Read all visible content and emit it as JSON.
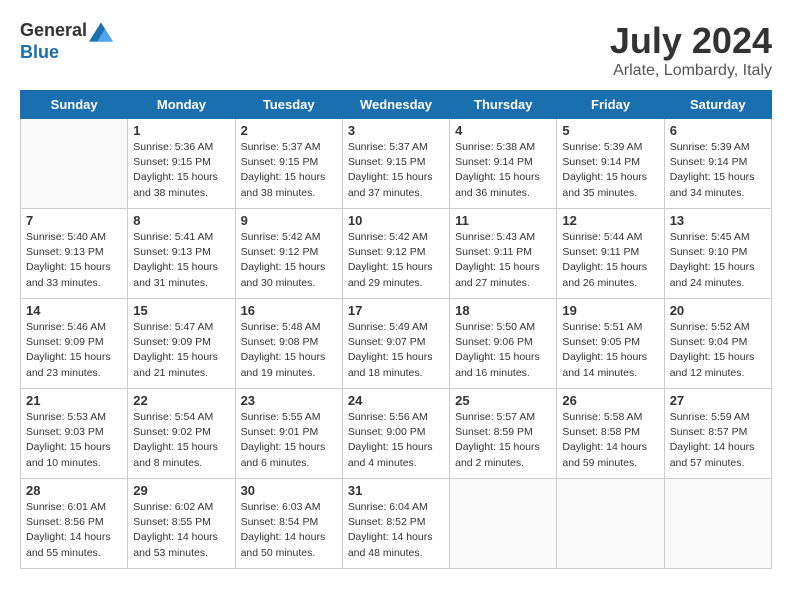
{
  "header": {
    "logo": {
      "general": "General",
      "blue": "Blue"
    },
    "title": "July 2024",
    "location": "Arlate, Lombardy, Italy"
  },
  "days_of_week": [
    "Sunday",
    "Monday",
    "Tuesday",
    "Wednesday",
    "Thursday",
    "Friday",
    "Saturday"
  ],
  "weeks": [
    [
      {
        "day": "",
        "info": ""
      },
      {
        "day": "1",
        "info": "Sunrise: 5:36 AM\nSunset: 9:15 PM\nDaylight: 15 hours\nand 38 minutes."
      },
      {
        "day": "2",
        "info": "Sunrise: 5:37 AM\nSunset: 9:15 PM\nDaylight: 15 hours\nand 38 minutes."
      },
      {
        "day": "3",
        "info": "Sunrise: 5:37 AM\nSunset: 9:15 PM\nDaylight: 15 hours\nand 37 minutes."
      },
      {
        "day": "4",
        "info": "Sunrise: 5:38 AM\nSunset: 9:14 PM\nDaylight: 15 hours\nand 36 minutes."
      },
      {
        "day": "5",
        "info": "Sunrise: 5:39 AM\nSunset: 9:14 PM\nDaylight: 15 hours\nand 35 minutes."
      },
      {
        "day": "6",
        "info": "Sunrise: 5:39 AM\nSunset: 9:14 PM\nDaylight: 15 hours\nand 34 minutes."
      }
    ],
    [
      {
        "day": "7",
        "info": "Sunrise: 5:40 AM\nSunset: 9:13 PM\nDaylight: 15 hours\nand 33 minutes."
      },
      {
        "day": "8",
        "info": "Sunrise: 5:41 AM\nSunset: 9:13 PM\nDaylight: 15 hours\nand 31 minutes."
      },
      {
        "day": "9",
        "info": "Sunrise: 5:42 AM\nSunset: 9:12 PM\nDaylight: 15 hours\nand 30 minutes."
      },
      {
        "day": "10",
        "info": "Sunrise: 5:42 AM\nSunset: 9:12 PM\nDaylight: 15 hours\nand 29 minutes."
      },
      {
        "day": "11",
        "info": "Sunrise: 5:43 AM\nSunset: 9:11 PM\nDaylight: 15 hours\nand 27 minutes."
      },
      {
        "day": "12",
        "info": "Sunrise: 5:44 AM\nSunset: 9:11 PM\nDaylight: 15 hours\nand 26 minutes."
      },
      {
        "day": "13",
        "info": "Sunrise: 5:45 AM\nSunset: 9:10 PM\nDaylight: 15 hours\nand 24 minutes."
      }
    ],
    [
      {
        "day": "14",
        "info": "Sunrise: 5:46 AM\nSunset: 9:09 PM\nDaylight: 15 hours\nand 23 minutes."
      },
      {
        "day": "15",
        "info": "Sunrise: 5:47 AM\nSunset: 9:09 PM\nDaylight: 15 hours\nand 21 minutes."
      },
      {
        "day": "16",
        "info": "Sunrise: 5:48 AM\nSunset: 9:08 PM\nDaylight: 15 hours\nand 19 minutes."
      },
      {
        "day": "17",
        "info": "Sunrise: 5:49 AM\nSunset: 9:07 PM\nDaylight: 15 hours\nand 18 minutes."
      },
      {
        "day": "18",
        "info": "Sunrise: 5:50 AM\nSunset: 9:06 PM\nDaylight: 15 hours\nand 16 minutes."
      },
      {
        "day": "19",
        "info": "Sunrise: 5:51 AM\nSunset: 9:05 PM\nDaylight: 15 hours\nand 14 minutes."
      },
      {
        "day": "20",
        "info": "Sunrise: 5:52 AM\nSunset: 9:04 PM\nDaylight: 15 hours\nand 12 minutes."
      }
    ],
    [
      {
        "day": "21",
        "info": "Sunrise: 5:53 AM\nSunset: 9:03 PM\nDaylight: 15 hours\nand 10 minutes."
      },
      {
        "day": "22",
        "info": "Sunrise: 5:54 AM\nSunset: 9:02 PM\nDaylight: 15 hours\nand 8 minutes."
      },
      {
        "day": "23",
        "info": "Sunrise: 5:55 AM\nSunset: 9:01 PM\nDaylight: 15 hours\nand 6 minutes."
      },
      {
        "day": "24",
        "info": "Sunrise: 5:56 AM\nSunset: 9:00 PM\nDaylight: 15 hours\nand 4 minutes."
      },
      {
        "day": "25",
        "info": "Sunrise: 5:57 AM\nSunset: 8:59 PM\nDaylight: 15 hours\nand 2 minutes."
      },
      {
        "day": "26",
        "info": "Sunrise: 5:58 AM\nSunset: 8:58 PM\nDaylight: 14 hours\nand 59 minutes."
      },
      {
        "day": "27",
        "info": "Sunrise: 5:59 AM\nSunset: 8:57 PM\nDaylight: 14 hours\nand 57 minutes."
      }
    ],
    [
      {
        "day": "28",
        "info": "Sunrise: 6:01 AM\nSunset: 8:56 PM\nDaylight: 14 hours\nand 55 minutes."
      },
      {
        "day": "29",
        "info": "Sunrise: 6:02 AM\nSunset: 8:55 PM\nDaylight: 14 hours\nand 53 minutes."
      },
      {
        "day": "30",
        "info": "Sunrise: 6:03 AM\nSunset: 8:54 PM\nDaylight: 14 hours\nand 50 minutes."
      },
      {
        "day": "31",
        "info": "Sunrise: 6:04 AM\nSunset: 8:52 PM\nDaylight: 14 hours\nand 48 minutes."
      },
      {
        "day": "",
        "info": ""
      },
      {
        "day": "",
        "info": ""
      },
      {
        "day": "",
        "info": ""
      }
    ]
  ]
}
